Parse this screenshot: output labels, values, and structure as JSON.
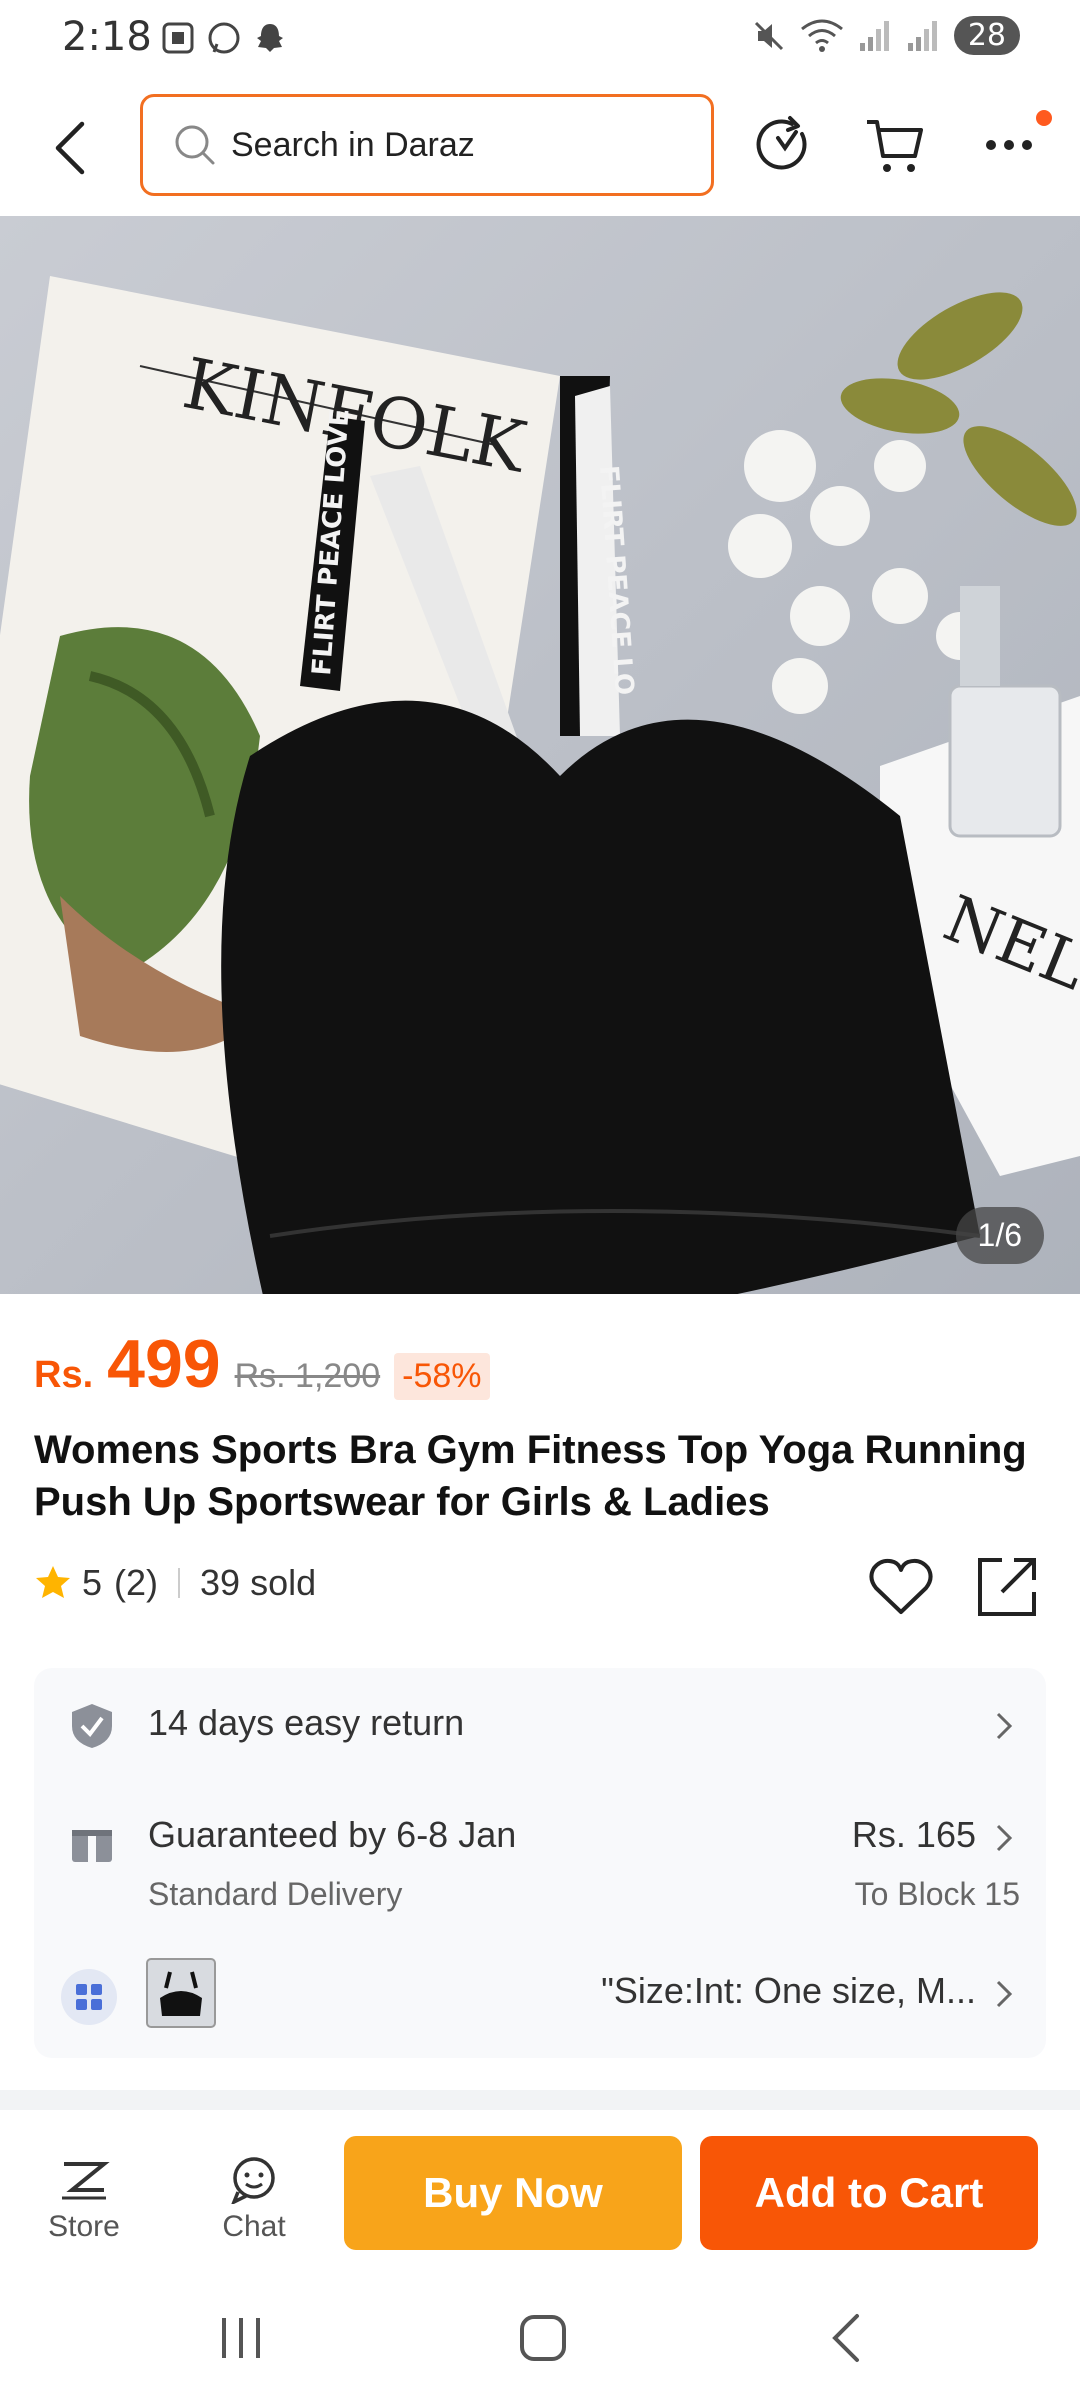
{
  "status_bar": {
    "time": "2:18",
    "battery": "28",
    "icons": [
      "screenshot-icon",
      "whatsapp-icon",
      "snapchat-icon",
      "mute-icon",
      "wifi-icon",
      "signal-icon",
      "signal-icon"
    ]
  },
  "nav": {
    "search_placeholder": "Search in Daraz"
  },
  "gallery": {
    "counter": "1/6"
  },
  "product": {
    "currency": "Rs.",
    "price": "499",
    "old_price": "Rs. 1,200",
    "discount": "-58%",
    "title": "Womens Sports Bra Gym Fitness Top Yoga Running Push Up Sportswear for Girls & Ladies",
    "rating": "5",
    "rating_count": "(2)",
    "sold": "39 sold"
  },
  "info": {
    "return_label": "14 days easy return",
    "delivery_label": "Guaranteed by 6-8 Jan",
    "delivery_type": "Standard Delivery",
    "delivery_price": "Rs. 165",
    "delivery_to": "To Block 15",
    "variant_label": "\"Size:Int: One size, M..."
  },
  "bottom_bar": {
    "store_label": "Store",
    "chat_label": "Chat",
    "buy_now": "Buy Now",
    "add_to_cart": "Add to Cart"
  },
  "colors": {
    "accent": "#f85606",
    "buy": "#f8a41a",
    "search_border": "#f26f21"
  }
}
